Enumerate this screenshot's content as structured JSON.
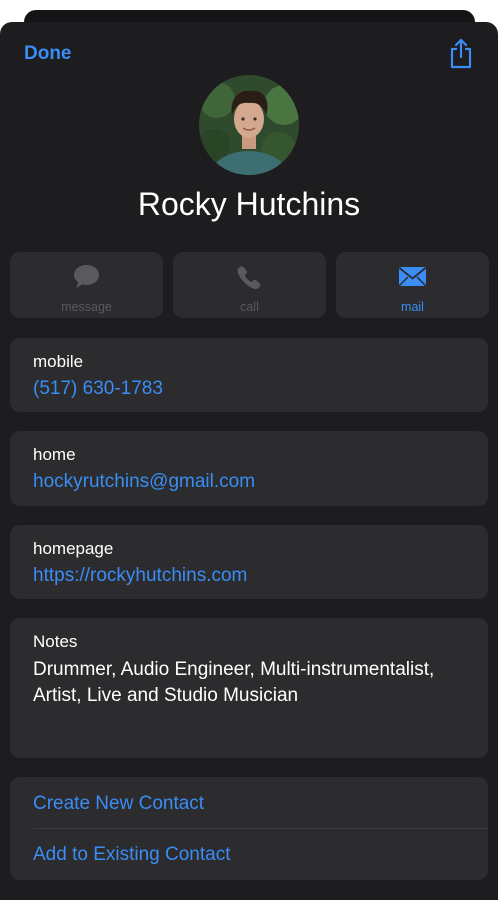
{
  "header": {
    "done_label": "Done"
  },
  "contact": {
    "name": "Rocky Hutchins"
  },
  "actions": [
    {
      "label": "message",
      "icon": "message-bubble-icon",
      "enabled": false
    },
    {
      "label": "call",
      "icon": "phone-icon",
      "enabled": false
    },
    {
      "label": "mail",
      "icon": "envelope-icon",
      "enabled": true
    }
  ],
  "fields": {
    "mobile": {
      "label": "mobile",
      "value": "(517) 630-1783"
    },
    "home": {
      "label": "home",
      "value": "hockyrutchins@gmail.com"
    },
    "homepage": {
      "label": "homepage",
      "value": "https://rockyhutchins.com"
    }
  },
  "notes": {
    "label": "Notes",
    "text": "Drummer, Audio Engineer, Multi-instrumentalist, Artist, Live and Studio Musician"
  },
  "links": {
    "create": "Create New Contact",
    "add": "Add to Existing Contact"
  },
  "colors": {
    "accent": "#3a8df5",
    "background": "#1d1c1f",
    "card": "#2c2b2e",
    "disabled": "#5a595d"
  }
}
